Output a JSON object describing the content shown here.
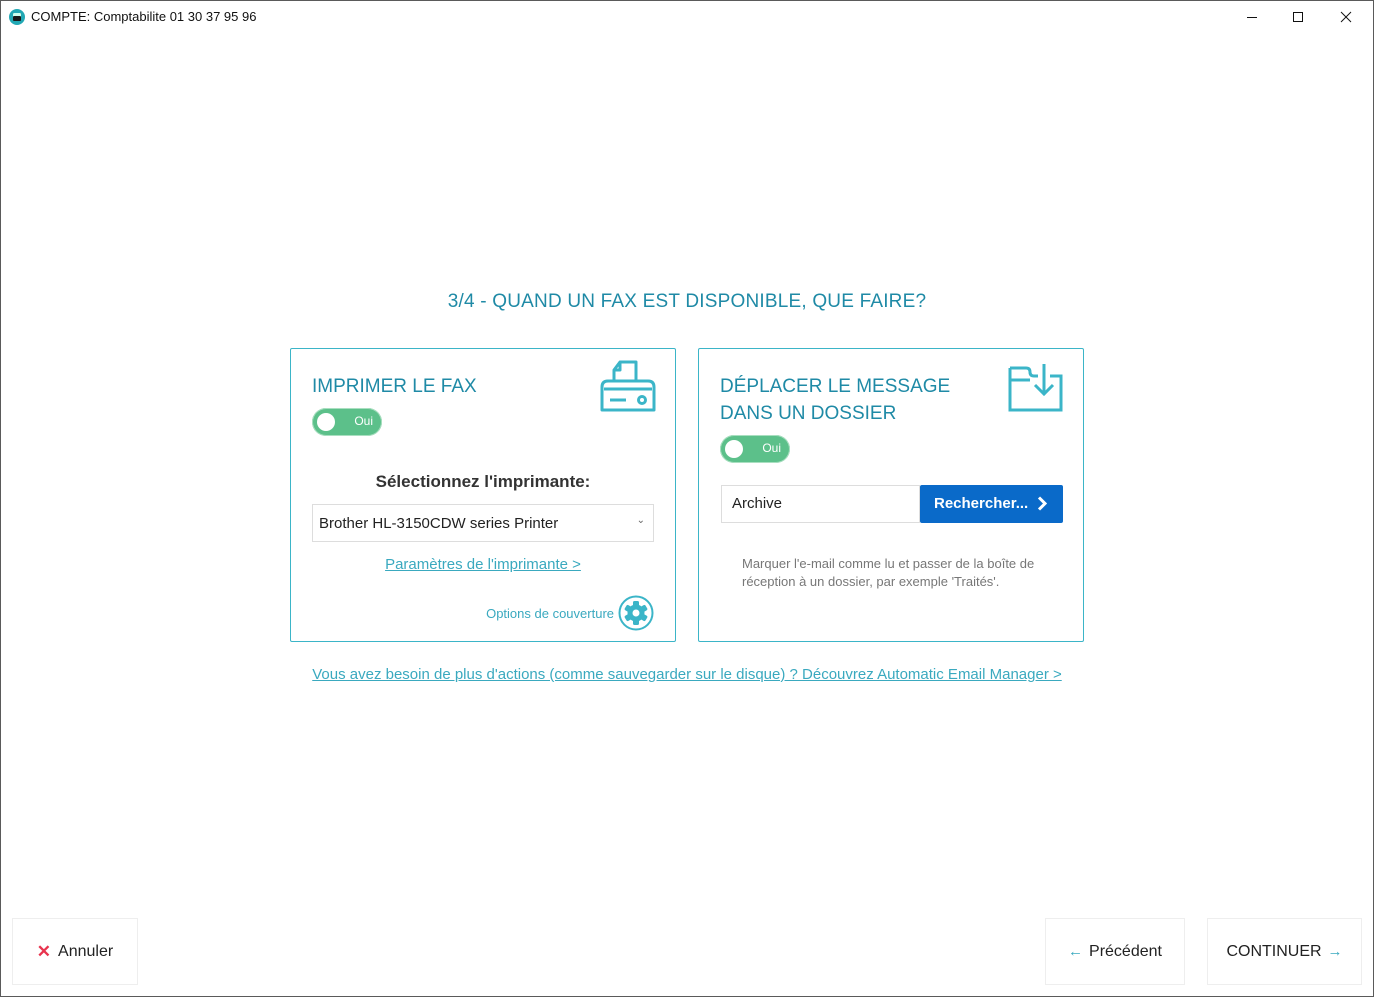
{
  "window": {
    "title": "COMPTE: Comptabilite 01 30 37 95 96",
    "app_icon": "fax-app-icon",
    "controls": [
      "minimize",
      "maximize",
      "close"
    ]
  },
  "step": {
    "title": "3/4 - QUAND UN FAX EST DISPONIBLE, QUE FAIRE?"
  },
  "print_card": {
    "title": "IMPRIMER LE FAX",
    "icon": "printer-icon",
    "toggle": {
      "label": "Oui",
      "on": true
    },
    "select_label": "Sélectionnez l'imprimante:",
    "printer_selected": "Brother HL-3150CDW series Printer",
    "printer_settings_link": "Paramètres de l'imprimante >",
    "cover_options_label": "Options de couverture",
    "cover_options_icon": "gear-icon"
  },
  "move_card": {
    "title": "DÉPLACER LE MESSAGE DANS UN DOSSIER",
    "icon": "folder-move-icon",
    "toggle": {
      "label": "Oui",
      "on": true
    },
    "folder_value": "Archive",
    "browse_label": "Rechercher...",
    "help_text": "Marquer l'e-mail comme lu et passer de la boîte de réception à un dossier, par exemple 'Traités'."
  },
  "footer_link": "Vous avez besoin de plus d'actions (comme sauvegarder sur le disque) ? Découvrez Automatic Email Manager >",
  "nav": {
    "cancel_label": "Annuler",
    "previous_label": "Précédent",
    "continue_label": "CONTINUER",
    "previous_arrow": "←",
    "continue_arrow": "→",
    "cancel_glyph": "✕"
  },
  "colors": {
    "accent": "#1f8aa6",
    "link": "#3aa9bf",
    "toggle_on": "#5cc08a",
    "primary_button": "#0a6ac9",
    "cancel_icon": "#e8344e"
  }
}
